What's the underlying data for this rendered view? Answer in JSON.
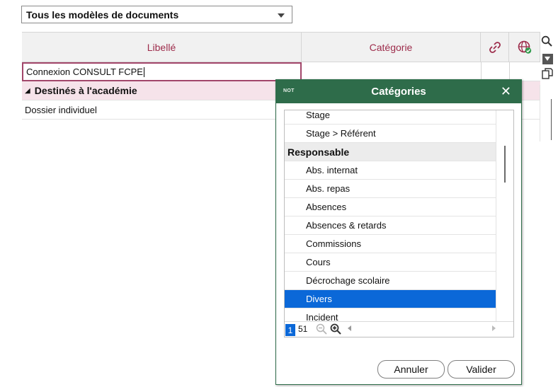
{
  "filter": {
    "label": "Tous les modèles de documents"
  },
  "grid": {
    "columns": {
      "libelle": "Libellé",
      "categorie": "Catégorie"
    },
    "input_value": "Connexion CONSULT FCPE",
    "group_label": "Destinés à l'académie",
    "item_label": "Dossier individuel"
  },
  "dialog": {
    "tag": "NOT",
    "title": "Catégories",
    "close": "✕",
    "items": [
      {
        "label": "Stage",
        "type": "item"
      },
      {
        "label": "Stage > Référent",
        "type": "item"
      },
      {
        "label": "Responsable",
        "type": "head"
      },
      {
        "label": "Abs. internat",
        "type": "item"
      },
      {
        "label": "Abs. repas",
        "type": "item"
      },
      {
        "label": "Absences",
        "type": "item"
      },
      {
        "label": "Absences & retards",
        "type": "item"
      },
      {
        "label": "Commissions",
        "type": "item"
      },
      {
        "label": "Cours",
        "type": "item"
      },
      {
        "label": "Décrochage scolaire",
        "type": "item"
      },
      {
        "label": "Divers",
        "type": "selected"
      },
      {
        "label": "Incident",
        "type": "item"
      }
    ],
    "pager": {
      "page": "1",
      "count": "51"
    },
    "buttons": {
      "cancel": "Annuler",
      "ok": "Valider"
    }
  },
  "colors": {
    "accent": "#9d2c4b",
    "dialog_header": "#2e6c4a",
    "selection": "#0b68d8"
  }
}
